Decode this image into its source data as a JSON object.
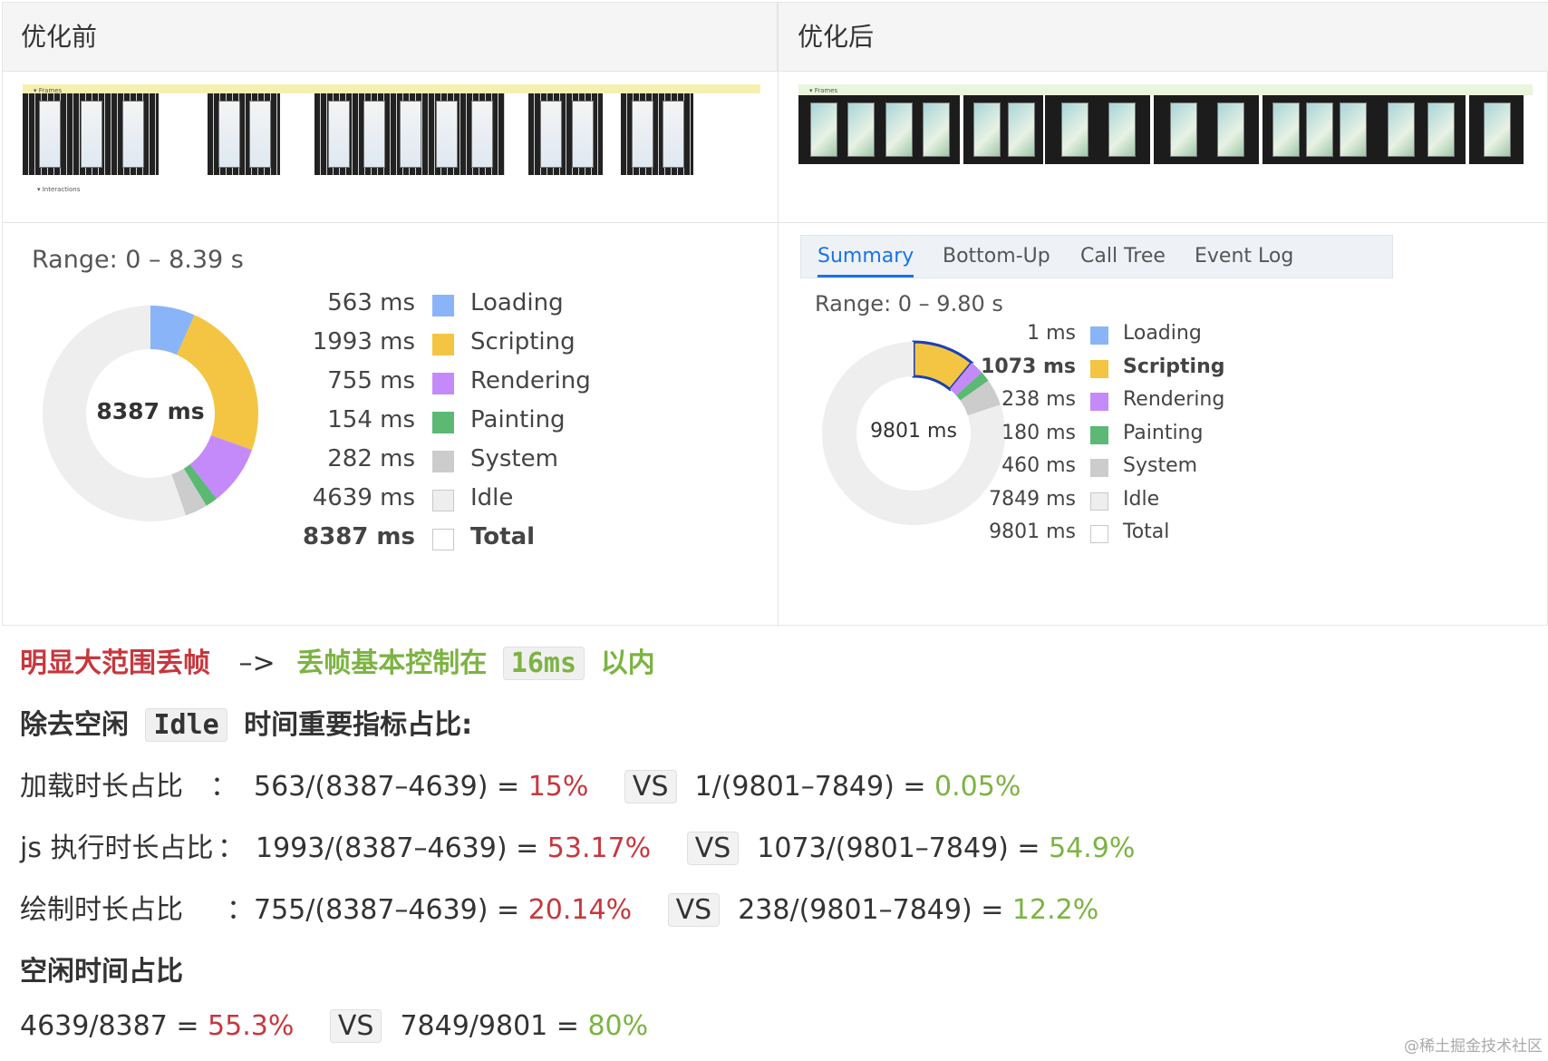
{
  "headers": {
    "before": "优化前",
    "after": "优化后"
  },
  "strip_before": {
    "frames_label": "▾ Frames",
    "interactions_label": "▾ Interactions"
  },
  "strip_after": {
    "frames_label": "▾ Frames"
  },
  "before_summary": {
    "range": "Range: 0 – 8.39 s",
    "center": "8387 ms",
    "rows": [
      {
        "value": "563 ms",
        "label": "Loading",
        "color": "#8ab4f8"
      },
      {
        "value": "1993 ms",
        "label": "Scripting",
        "color": "#f4c542"
      },
      {
        "value": "755 ms",
        "label": "Rendering",
        "color": "#c58af9"
      },
      {
        "value": "154 ms",
        "label": "Painting",
        "color": "#5bb974"
      },
      {
        "value": "282 ms",
        "label": "System",
        "color": "#cccccc"
      },
      {
        "value": "4639 ms",
        "label": "Idle",
        "color": "#eeeeee"
      },
      {
        "value": "8387 ms",
        "label": "Total",
        "color": "#ffffff"
      }
    ]
  },
  "after_summary": {
    "tabs": [
      "Summary",
      "Bottom-Up",
      "Call Tree",
      "Event Log"
    ],
    "range": "Range: 0 – 9.80 s",
    "center": "9801 ms",
    "rows": [
      {
        "value": "1 ms",
        "label": "Loading",
        "color": "#8ab4f8"
      },
      {
        "value": "1073 ms",
        "label": "Scripting",
        "color": "#f4c542"
      },
      {
        "value": "238 ms",
        "label": "Rendering",
        "color": "#c58af9"
      },
      {
        "value": "180 ms",
        "label": "Painting",
        "color": "#5bb974"
      },
      {
        "value": "460 ms",
        "label": "System",
        "color": "#cccccc"
      },
      {
        "value": "7849 ms",
        "label": "Idle",
        "color": "#eeeeee"
      },
      {
        "value": "9801 ms",
        "label": "Total",
        "color": "#ffffff"
      }
    ]
  },
  "chart_data": [
    {
      "type": "pie",
      "title": "",
      "categories": [
        "Loading",
        "Scripting",
        "Rendering",
        "Painting",
        "System",
        "Idle"
      ],
      "values": [
        563,
        1993,
        755,
        154,
        282,
        4639
      ],
      "center_label": "8387 ms"
    },
    {
      "type": "pie",
      "title": "",
      "categories": [
        "Loading",
        "Scripting",
        "Rendering",
        "Painting",
        "System",
        "Idle"
      ],
      "values": [
        1,
        1073,
        238,
        180,
        460,
        7849
      ],
      "center_label": "9801 ms"
    }
  ],
  "notes": {
    "line1_red": "明显大范围丢帧",
    "line1_arrow": "–>",
    "line1_green_a": "丢帧基本控制在",
    "line1_code": "16ms",
    "line1_green_b": "以内",
    "line2_a": "除去空闲",
    "line2_code": "Idle",
    "line2_b": "时间重要指标占比:",
    "row_load": {
      "label": "加载时长占比",
      "colon": "：",
      "before": "563/(8387–4639) = ",
      "before_pct": "15%",
      "vs": "VS",
      "after": "1/(9801–7849) = ",
      "after_pct": "0.05%"
    },
    "row_js": {
      "label": "js 执行时长占比",
      "colon": "：",
      "before": "1993/(8387–4639) = ",
      "before_pct": "53.17%",
      "vs": "VS",
      "after": "1073/(9801–7849) = ",
      "after_pct": "54.9%"
    },
    "row_paint": {
      "label": "绘制时长占比",
      "colon": "：",
      "before": "755/(8387–4639) = ",
      "before_pct": "20.14%",
      "vs": "VS",
      "after": "238/(9801–7849) = ",
      "after_pct": "12.2%"
    },
    "idle_heading": "空闲时间占比",
    "row_idle": {
      "before": "4639/8387 = ",
      "before_pct": "55.3%",
      "vs": "VS",
      "after": "7849/9801 = ",
      "after_pct": "80%"
    }
  },
  "watermark": "@稀土掘金技术社区"
}
